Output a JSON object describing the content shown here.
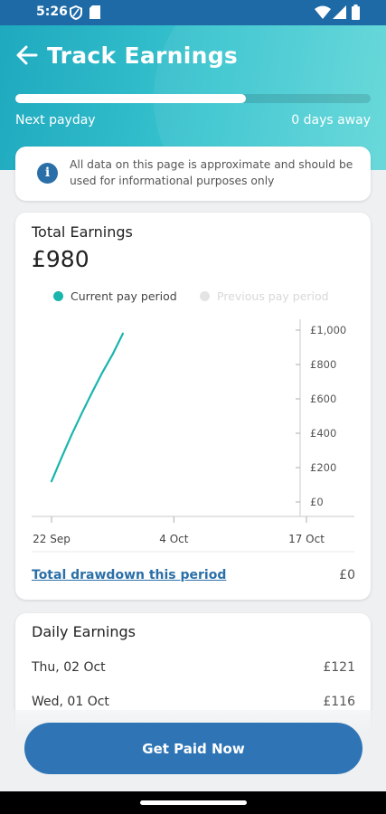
{
  "status_bar": {
    "time": "5:26",
    "left_icons": [
      "shield-icon",
      "sd-card-icon"
    ],
    "right_icons": [
      "wifi-icon",
      "signal-icon",
      "battery-icon"
    ]
  },
  "header": {
    "title": "Track Earnings",
    "progress_fraction": 0.65,
    "payday_label": "Next payday",
    "payday_value": "0 days away"
  },
  "notice": {
    "icon": "info-icon",
    "text": "All data on this page is approximate and should be used for informational purposes only"
  },
  "total_earnings": {
    "title": "Total Earnings",
    "amount": "£980",
    "drawdown_label": "Total drawdown this period",
    "drawdown_value": "£0"
  },
  "chart_data": {
    "type": "line",
    "legend": [
      {
        "label": "Current pay period",
        "color": "#1ab5ad"
      },
      {
        "label": "Previous pay period",
        "color": "#e4e4e4"
      }
    ],
    "x_ticks": [
      "22 Sep",
      "4 Oct",
      "17 Oct"
    ],
    "y_ticks": [
      "£0",
      "£200",
      "£400",
      "£600",
      "£800",
      "£1,000"
    ],
    "ylim": [
      0,
      1000
    ],
    "x_tick_days": [
      0,
      12,
      25
    ],
    "series": [
      {
        "color": "#1ab5ad",
        "points": [
          [
            0,
            120
          ],
          [
            1,
            260
          ],
          [
            2,
            395
          ],
          [
            3,
            520
          ],
          [
            4,
            640
          ],
          [
            5,
            755
          ],
          [
            6,
            860
          ],
          [
            7,
            980
          ]
        ]
      }
    ]
  },
  "daily_earnings": {
    "title": "Daily Earnings",
    "rows": [
      {
        "date": "Thu, 02 Oct",
        "amount": "£121"
      },
      {
        "date": "Wed, 01 Oct",
        "amount": "£116"
      }
    ]
  },
  "cta": {
    "label": "Get Paid Now"
  }
}
